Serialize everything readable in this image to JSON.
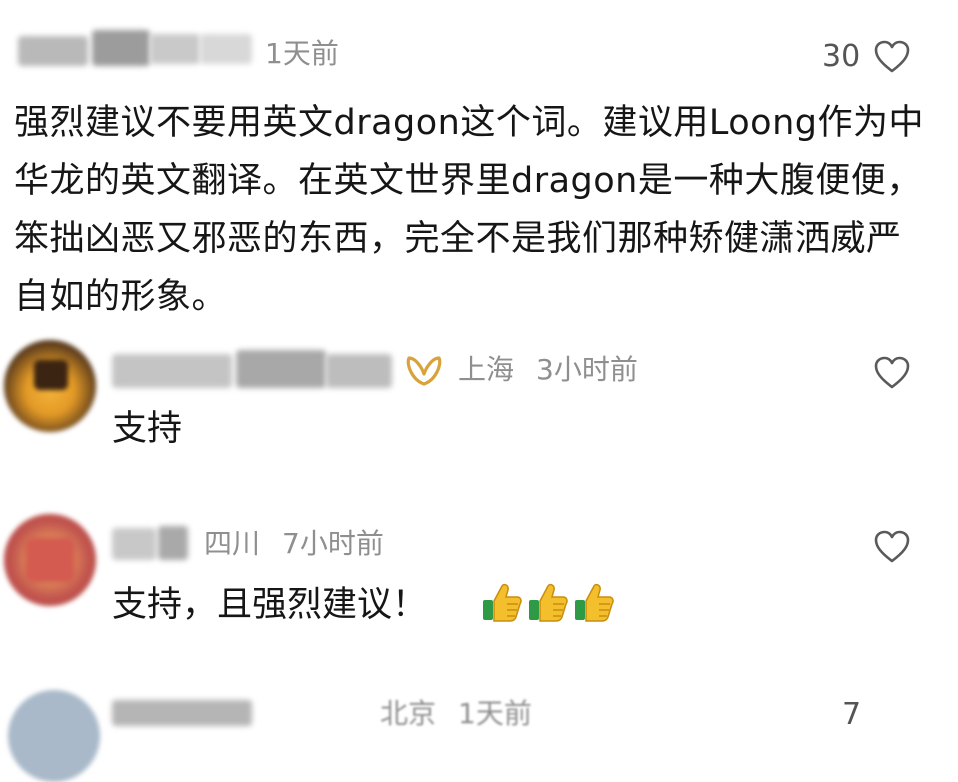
{
  "main_comment": {
    "time": "1天前",
    "like_count": "30",
    "text": "强烈建议不要用英文dragon这个词。建议用Loong作为中华龙的英文翻译。在英文世界里dragon是一种大腹便便，笨拙凶恶又邪恶的东西，完全不是我们那种矫健潇洒威严自如的形象。",
    "icons": {
      "like": "heart-outline-icon"
    }
  },
  "replies": [
    {
      "location": "上海",
      "time": "3小时前",
      "text": "支持",
      "badge_icon": "gold-ribbon-badge-icon",
      "like_icon": "heart-outline-icon"
    },
    {
      "location": "四川",
      "time": "7小时前",
      "text": "支持，且强烈建议！",
      "emojis": [
        "thumbs-up-icon",
        "thumbs-up-icon",
        "thumbs-up-icon"
      ],
      "like_icon": "heart-outline-icon"
    },
    {
      "location": "北京",
      "time": "1天前",
      "like_count": "7"
    }
  ],
  "colors": {
    "text": "#161616",
    "meta": "#8f8f8f",
    "badge_gold": "#d9a23b",
    "thumb_yellow": "#f3bf2c",
    "thumb_green": "#2f9a46"
  }
}
